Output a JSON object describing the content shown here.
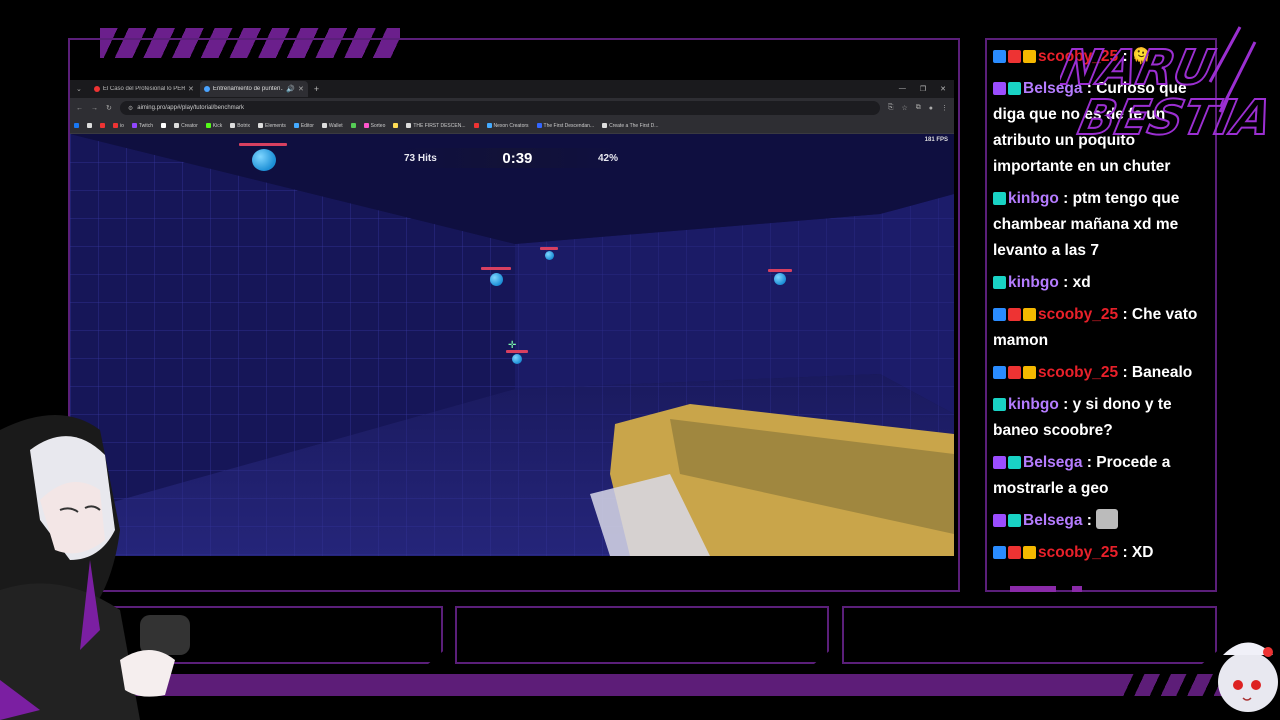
{
  "browser": {
    "tabs": [
      {
        "label": "El Caso del Profesional lo PERD...",
        "color": "#e33"
      },
      {
        "label": "Entrenamiento de punterí...",
        "color": "#4aa3ff",
        "active": true
      }
    ],
    "url": "aiming.pro/app#/play/tutorial/benchmark",
    "bookmarks": [
      {
        "label": "",
        "color": "#1877f2"
      },
      {
        "label": "",
        "color": "#ddd"
      },
      {
        "label": "",
        "color": "#e33"
      },
      {
        "label": "io",
        "color": "#e33"
      },
      {
        "label": "Twitch",
        "color": "#9146ff"
      },
      {
        "label": "",
        "color": "#fff"
      },
      {
        "label": "Creator",
        "color": "#ddd"
      },
      {
        "label": "Kick",
        "color": "#53fc18"
      },
      {
        "label": "Botrix",
        "color": "#ddd"
      },
      {
        "label": "Elements",
        "color": "#ddd"
      },
      {
        "label": "Editor",
        "color": "#4af"
      },
      {
        "label": "Wallet",
        "color": "#ddd"
      },
      {
        "label": "",
        "color": "#5c5"
      },
      {
        "label": "Sorteo",
        "color": "#f5c"
      },
      {
        "label": "",
        "color": "#fd5"
      },
      {
        "label": "THE FIRST DESCEN...",
        "color": "#ddd"
      },
      {
        "label": "",
        "color": "#e33"
      },
      {
        "label": "Nexon Creators",
        "color": "#4af"
      },
      {
        "label": "The First Descendan...",
        "color": "#36f"
      },
      {
        "label": "Create a The First D...",
        "color": "#ddd"
      }
    ]
  },
  "game": {
    "hits": "73 Hits",
    "timer": "0:39",
    "accuracy": "42%",
    "fps": "181 FPS"
  },
  "chat": {
    "messages": [
      {
        "user": "scooby_25",
        "color": "#e8202a",
        "badges": [
          "#2a8cff",
          "#e33",
          "#f5b800"
        ],
        "text": ": 🫠"
      },
      {
        "user": "Belsega",
        "color": "#b57cff",
        "badges": [
          "#9b4dff",
          "#19d3c5"
        ],
        "text": ": Curioso que diga que no es de fe un atributo un poquito importante en un chuter"
      },
      {
        "user": "kinbgo",
        "color": "#b57cff",
        "badges": [
          "#19d3c5"
        ],
        "text": ": ptm tengo que chambear mañana xd me levanto a las 7"
      },
      {
        "user": "kinbgo",
        "color": "#b57cff",
        "badges": [
          "#19d3c5"
        ],
        "text": ": xd"
      },
      {
        "user": "scooby_25",
        "color": "#e8202a",
        "badges": [
          "#2a8cff",
          "#e33",
          "#f5b800"
        ],
        "text": ": Che vato mamon"
      },
      {
        "user": "scooby_25",
        "color": "#e8202a",
        "badges": [
          "#2a8cff",
          "#e33",
          "#f5b800"
        ],
        "text": ": Banealo"
      },
      {
        "user": "kinbgo",
        "color": "#b57cff",
        "badges": [
          "#19d3c5"
        ],
        "text": ": y si dono y te baneo scoobre?"
      },
      {
        "user": "Belsega",
        "color": "#b57cff",
        "badges": [
          "#9b4dff",
          "#19d3c5"
        ],
        "text": ": Procede a mostrarle a geo"
      },
      {
        "user": "Belsega",
        "color": "#b57cff",
        "badges": [
          "#9b4dff",
          "#19d3c5"
        ],
        "text": ": ",
        "emote": "cat-emote"
      },
      {
        "user": "scooby_25",
        "color": "#e8202a",
        "badges": [
          "#2a8cff",
          "#e33",
          "#f5b800"
        ],
        "text": ": XD"
      }
    ]
  },
  "logo": {
    "line1": "NARU",
    "line2": "BESTIA",
    "color": "#9b2fd1"
  },
  "accent": "#5b1f7a"
}
